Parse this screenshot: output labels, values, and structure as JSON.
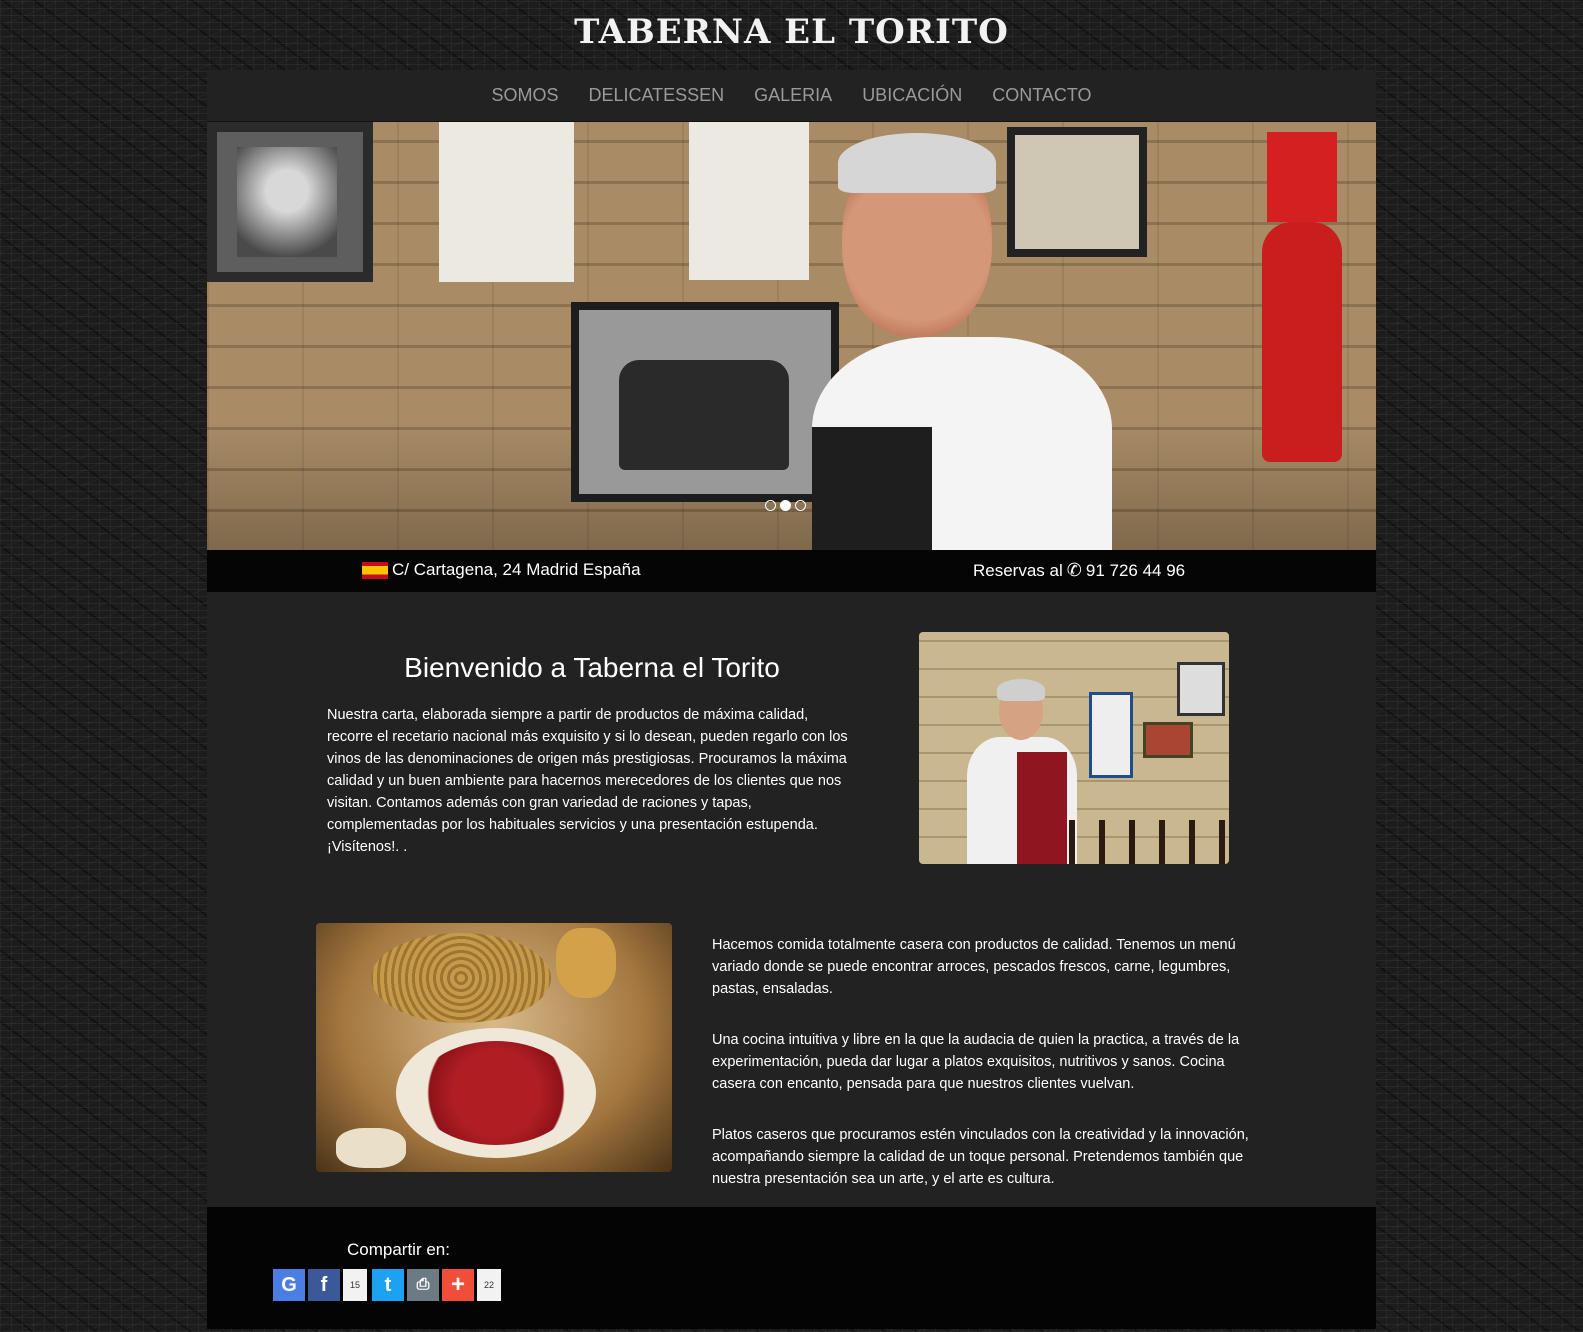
{
  "header": {
    "logo_text": "TABERNA  EL TORITO"
  },
  "nav": {
    "items": [
      {
        "label": "SOMOS"
      },
      {
        "label": "DELICATESSEN"
      },
      {
        "label": "GALERIA"
      },
      {
        "label": "UBICACIÓN"
      },
      {
        "label": "CONTACTO"
      }
    ]
  },
  "slider": {
    "slide_count": 3,
    "active_index": 1
  },
  "infobar": {
    "address": "C/ Cartagena, 24 Madrid España",
    "reservations_prefix": "Reservas al",
    "phone": "91 726 44 96",
    "phone_icon": "phone-icon",
    "flag_icon": "spain-flag-icon"
  },
  "welcome": {
    "title": "Bienvenido a Taberna el Torito",
    "text": "Nuestra carta, elaborada siempre a partir de productos de máxima calidad, recorre el recetario nacional más exquisito y si lo desean, pueden regarlo con los vinos de las denominaciones de origen más prestigiosas. Procuramos la máxima calidad y un buen ambiente para hacernos merecedores de los clientes que nos visitan. Contamos además con gran variedad de raciones y tapas, complementadas por los habituales servicios y una presentación estupenda. ¡Visítenos!. ."
  },
  "kitchen": {
    "paragraph1": "Hacemos comida totalmente casera con productos de calidad. Tenemos un menú variado donde se puede encontrar arroces, pescados frescos, carne, legumbres, pastas, ensaladas.",
    "paragraph2": "Una cocina intuitiva y libre en la que la audacia de quien la practica, a través de la experimentación, pueda dar lugar a platos exquisitos, nutritivos y sanos. Cocina casera con encanto, pensada para que nuestros clientes vuelvan.",
    "paragraph3": "Platos caseros que procuramos estén vinculados con la creatividad y la innovación, acompañando siempre la calidad de un toque personal. Pretendemos también que nuestra presentación sea un arte, y el arte es cultura."
  },
  "share": {
    "label": "Compartir en:",
    "buttons": [
      {
        "icon": "google-icon",
        "glyph": "G"
      },
      {
        "icon": "facebook-icon",
        "glyph": "f",
        "count": "15"
      },
      {
        "icon": "twitter-icon",
        "glyph": "t"
      },
      {
        "icon": "print-icon",
        "glyph": "⎙"
      },
      {
        "icon": "addthis-icon",
        "glyph": "+",
        "count": "22"
      }
    ]
  },
  "colors": {
    "nav_text": "#9a9a9a",
    "content_bg": "#222222",
    "infobar_bg": "#050505",
    "footer_bg": "#040404"
  }
}
